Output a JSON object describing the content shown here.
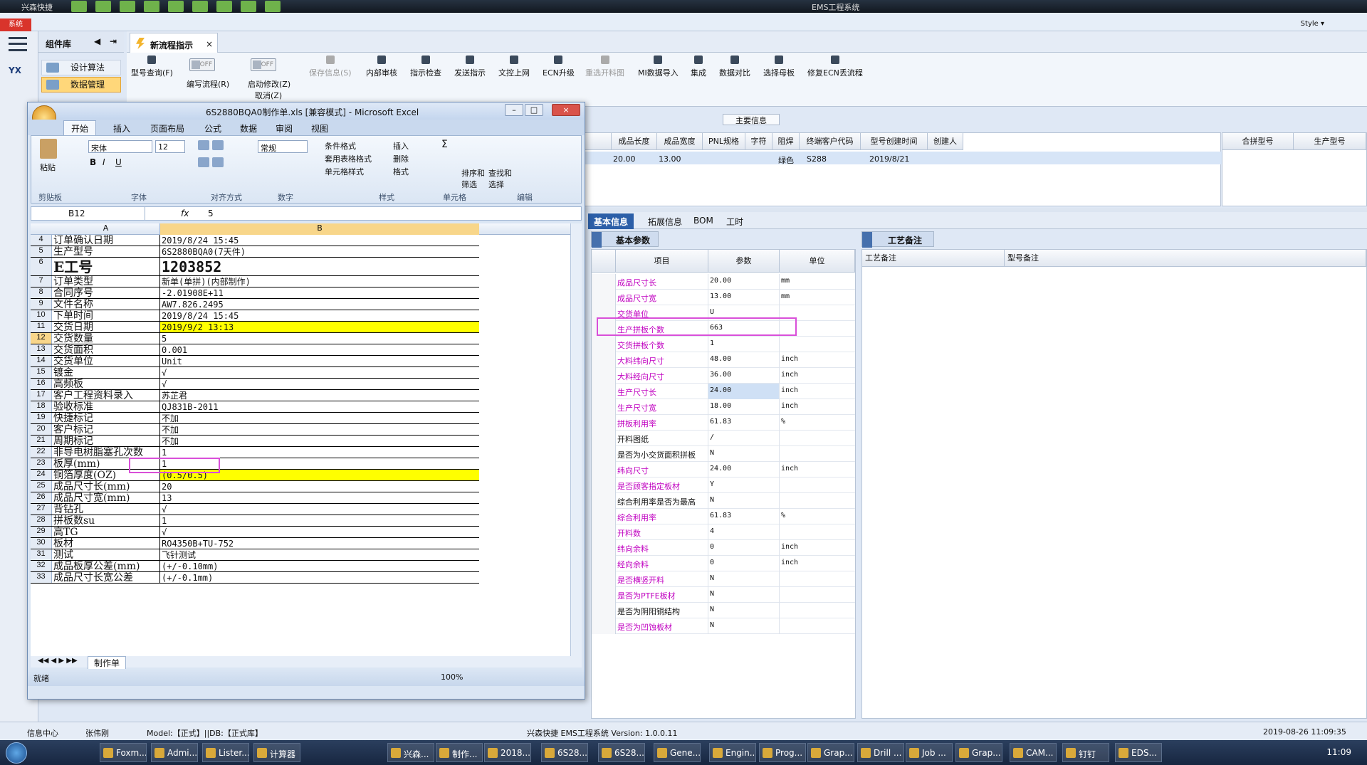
{
  "app": {
    "title": "兴森快捷",
    "window_title": "EMS工程系统",
    "system_btn": "系统",
    "style_label": "Style ▾"
  },
  "left": {
    "comp_lib": "组件库",
    "items": [
      {
        "label": "设计算法"
      },
      {
        "label": "数据管理"
      }
    ],
    "logo": "YX"
  },
  "tab": {
    "label": "新流程指示"
  },
  "ribbon": {
    "buttons": [
      {
        "label": "型号查询(F)",
        "icon": "search-icon"
      },
      {
        "label": "保存信息(S)",
        "icon": "check-icon",
        "disabled": true
      },
      {
        "label": "内部审核",
        "icon": "printer-icon"
      },
      {
        "label": "指示检查",
        "icon": "check-box-icon"
      },
      {
        "label": "发送指示",
        "icon": "upload-icon"
      },
      {
        "label": "文控上网",
        "icon": "cloud-icon"
      },
      {
        "label": "ECN升级",
        "icon": "upgrade-icon"
      },
      {
        "label": "重选开料图",
        "icon": "image-icon",
        "disabled": true
      },
      {
        "label": "MI数据导入",
        "icon": "import-icon"
      },
      {
        "label": "集成",
        "icon": "download-icon"
      },
      {
        "label": "数据对比",
        "icon": "compare-icon"
      },
      {
        "label": "选择母板",
        "icon": "select-icon"
      },
      {
        "label": "修复ECN丢流程",
        "icon": "wrench-icon"
      }
    ],
    "toggles": [
      {
        "label": "编写流程(R)",
        "state": "OFF"
      },
      {
        "label": "启动修改(Z)",
        "state": "OFF",
        "sub": "取消(Z)"
      }
    ]
  },
  "main_info": {
    "title": "主要信息",
    "headers": [
      "成品长度",
      "成品宽度",
      "PNL规格",
      "字符",
      "阻焊",
      "终端客户代码",
      "型号创建时间",
      "创建人"
    ],
    "row": [
      "20.00",
      "13.00",
      "",
      "",
      "绿色",
      "S288",
      "2019/8/21",
      ""
    ]
  },
  "merge": {
    "headers": [
      "合拼型号",
      "生产型号"
    ]
  },
  "bottom_tabs": [
    "基本信息",
    "拓展信息",
    "BOM",
    "工时"
  ],
  "basic": {
    "title": "基本参数",
    "headers": [
      "项目",
      "参数",
      "单位"
    ],
    "rows": [
      {
        "item": "成品尺寸长",
        "param": "20.00",
        "unit": "mm",
        "pink": true
      },
      {
        "item": "成品尺寸宽",
        "param": "13.00",
        "unit": "mm",
        "pink": true
      },
      {
        "item": "交货单位",
        "param": "U",
        "unit": "",
        "pink": true
      },
      {
        "item": "生产拼板个数",
        "param": "663",
        "unit": "",
        "pink": true
      },
      {
        "item": "交货拼板个数",
        "param": "1",
        "unit": "",
        "pink": true
      },
      {
        "item": "大料纬向尺寸",
        "param": "48.00",
        "unit": "inch",
        "pink": true
      },
      {
        "item": "大料经向尺寸",
        "param": "36.00",
        "unit": "inch",
        "pink": true
      },
      {
        "item": "生产尺寸长",
        "param": "24.00",
        "unit": "inch",
        "pink": true
      },
      {
        "item": "生产尺寸宽",
        "param": "18.00",
        "unit": "inch",
        "pink": true
      },
      {
        "item": "拼板利用率",
        "param": "61.83",
        "unit": "%",
        "pink": true
      },
      {
        "item": "开料图纸",
        "param": "/",
        "unit": "",
        "pink": false
      },
      {
        "item": "是否为小交货面积拼板",
        "param": "N",
        "unit": "",
        "pink": false
      },
      {
        "item": "纬向尺寸",
        "param": "24.00",
        "unit": "inch",
        "pink": true
      },
      {
        "item": "是否顾客指定板材",
        "param": "Y",
        "unit": "",
        "pink": true
      },
      {
        "item": "综合利用率是否为最高",
        "param": "N",
        "unit": "",
        "pink": false
      },
      {
        "item": "综合利用率",
        "param": "61.83",
        "unit": "%",
        "pink": true
      },
      {
        "item": "开料数",
        "param": "4",
        "unit": "",
        "pink": true
      },
      {
        "item": "纬向余料",
        "param": "0",
        "unit": "inch",
        "pink": true
      },
      {
        "item": "经向余料",
        "param": "0",
        "unit": "inch",
        "pink": true
      },
      {
        "item": "是否横竖开料",
        "param": "N",
        "unit": "",
        "pink": true
      },
      {
        "item": "是否为PTFE板材",
        "param": "N",
        "unit": "",
        "pink": true
      },
      {
        "item": "是否为阴阳铜结构",
        "param": "N",
        "unit": "",
        "pink": false
      },
      {
        "item": "是否为凹蚀板材",
        "param": "N",
        "unit": "",
        "pink": true
      }
    ]
  },
  "craft": {
    "title": "工艺备注",
    "col1": "工艺备注",
    "col2": "型号备注"
  },
  "excel": {
    "title": "6S2880BQA0制作单.xls [兼容模式] - Microsoft Excel",
    "tabs": [
      "开始",
      "插入",
      "页面布局",
      "公式",
      "数据",
      "审阅",
      "视图"
    ],
    "font": "宋体",
    "size": "12",
    "numfmt": "常规",
    "groups": [
      "剪贴板",
      "字体",
      "对齐方式",
      "数字",
      "样式",
      "单元格",
      "编辑"
    ],
    "ribbon_labels": {
      "paste": "粘贴",
      "cond": "条件格式",
      "tblfmt": "套用表格格式",
      "cellstyle": "单元格样式",
      "insert": "插入",
      "delete": "删除",
      "format": "格式",
      "sort": "排序和\n筛选",
      "find": "查找和\n选择"
    },
    "namebox": "B12",
    "fx": "fx",
    "formula": "5",
    "colA": "A",
    "colB": "B",
    "rows": [
      {
        "n": "4",
        "a": "订单确认日期",
        "b": "2019/8/24 15:45"
      },
      {
        "n": "5",
        "a": "生产型号",
        "b": "6S2880BQA0(7天件)"
      },
      {
        "n": "6",
        "a": "E工号",
        "b": "1203852",
        "big": true
      },
      {
        "n": "7",
        "a": "订单类型",
        "b": "新单(单拼)(内部制作)"
      },
      {
        "n": "8",
        "a": "合同序号",
        "b": "-2.01908E+11"
      },
      {
        "n": "9",
        "a": "文件名称",
        "b": "AW7.826.2495"
      },
      {
        "n": "10",
        "a": "下单时间",
        "b": "2019/8/24 15:45"
      },
      {
        "n": "11",
        "a": "交货日期",
        "b": "2019/9/2 13:13",
        "yellow": true
      },
      {
        "n": "12",
        "a": "交货数量",
        "b": "5"
      },
      {
        "n": "13",
        "a": "交货面积",
        "b": "0.001"
      },
      {
        "n": "14",
        "a": "交货单位",
        "b": "Unit"
      },
      {
        "n": "15",
        "a": "镀金",
        "b": "√"
      },
      {
        "n": "16",
        "a": "高频板",
        "b": "√"
      },
      {
        "n": "17",
        "a": "客户工程资料录入",
        "b": "苏芷君"
      },
      {
        "n": "18",
        "a": "验收标准",
        "b": "QJ831B-2011"
      },
      {
        "n": "19",
        "a": "快捷标记",
        "b": "不加"
      },
      {
        "n": "20",
        "a": "客户标记",
        "b": "不加"
      },
      {
        "n": "21",
        "a": "周期标记",
        "b": "不加"
      },
      {
        "n": "22",
        "a": "非导电树脂塞孔次数",
        "b": "1"
      },
      {
        "n": "23",
        "a": "板厚(mm)",
        "b": "1"
      },
      {
        "n": "24",
        "a": "铜箔厚度(OZ)",
        "b": "(0.5/0.5)",
        "yellow": true
      },
      {
        "n": "25",
        "a": "成品尺寸长(mm)",
        "b": "20"
      },
      {
        "n": "26",
        "a": "成品尺寸宽(mm)",
        "b": "13"
      },
      {
        "n": "27",
        "a": "背钻孔",
        "b": "√"
      },
      {
        "n": "28",
        "a": "拼板数su",
        "b": "1"
      },
      {
        "n": "29",
        "a": "高TG",
        "b": "√"
      },
      {
        "n": "30",
        "a": "板材",
        "b": "RO4350B+TU-752"
      },
      {
        "n": "31",
        "a": "测试",
        "b": "飞针测试"
      },
      {
        "n": "32",
        "a": "成品板厚公差(mm)",
        "b": "(+/-0.10mm)"
      },
      {
        "n": "33",
        "a": "成品尺寸长宽公差",
        "b": "(+/-0.1mm)"
      }
    ],
    "sheet_tab": "制作单",
    "status": "就绪",
    "zoom": "100%"
  },
  "status": {
    "info_center": "信息中心",
    "user": "张伟刚",
    "model": "Model:【正式】||DB:【正式库】",
    "system": "兴森快捷 EMS工程系统 Version: 1.0.0.11",
    "datetime": "2019-08-26 11:09:35"
  },
  "taskbar": {
    "items": [
      "Foxm...",
      "Admi...",
      "Lister...",
      "计算器",
      "兴森...",
      "制作...",
      "2018...",
      "6S28...",
      "6S28...",
      "Gene...",
      "Engin...",
      "Prog...",
      "Grap...",
      "Drill ...",
      "Job ...",
      "Grap...",
      "CAM...",
      "钉钉",
      "EDS..."
    ],
    "clock": "11:09"
  },
  "colors": {
    "pink": "#c000c0",
    "highlight": "#d94fd9",
    "accent": "#2c5fa8",
    "yellow": "#ffff00"
  }
}
